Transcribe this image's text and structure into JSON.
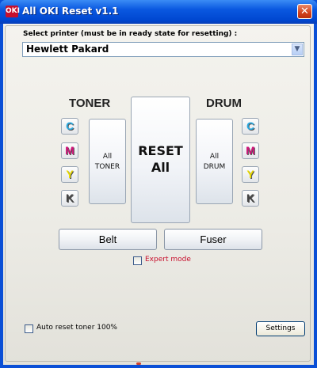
{
  "window": {
    "title": "All OKI Reset v1.1",
    "icon_text": "OKI"
  },
  "printer": {
    "label": "Select printer (must be in ready state for resetting) :",
    "selected": "Hewlett Pakard"
  },
  "toner": {
    "heading": "TONER",
    "colors": [
      {
        "letter": "C",
        "color": "#2aa9e0"
      },
      {
        "letter": "M",
        "color": "#d1147a"
      },
      {
        "letter": "Y",
        "color": "#e8d800"
      },
      {
        "letter": "K",
        "color": "#444444"
      }
    ],
    "all_line1": "All",
    "all_line2": "TONER"
  },
  "drum": {
    "heading": "DRUM",
    "colors": [
      {
        "letter": "C",
        "color": "#2aa9e0"
      },
      {
        "letter": "M",
        "color": "#d1147a"
      },
      {
        "letter": "Y",
        "color": "#e8d800"
      },
      {
        "letter": "K",
        "color": "#444444"
      }
    ],
    "all_line1": "All",
    "all_line2": "DRUM"
  },
  "reset": {
    "line1": "RESET",
    "line2": "All"
  },
  "belt": {
    "label": "Belt"
  },
  "fuser": {
    "label": "Fuser"
  },
  "expert": {
    "label": "Expert mode",
    "checked": false,
    "color": "#c8102e"
  },
  "auto_reset": {
    "label": "Auto reset toner 100%",
    "checked": false
  },
  "settings": {
    "label": "Settings"
  }
}
